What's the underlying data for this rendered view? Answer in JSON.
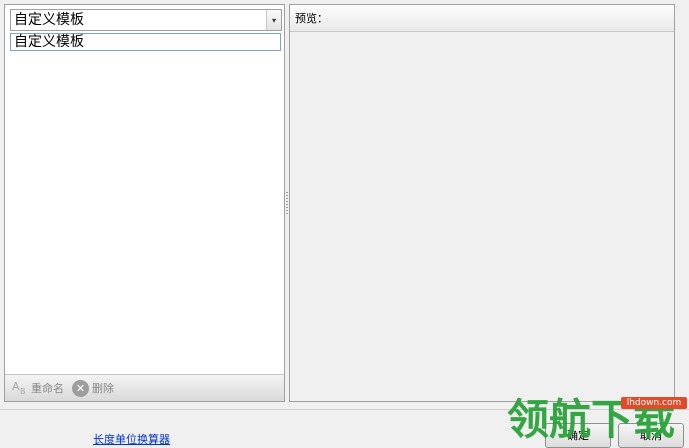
{
  "template_selector": {
    "selected": "自定义模板",
    "dropdown_glyph": "▾"
  },
  "template_list": {
    "items": [
      "自定义模板"
    ]
  },
  "left_toolbar": {
    "rename_label": "重命名",
    "delete_label": "删除",
    "rename_icon": "ab-rename-icon",
    "delete_icon": "x-circle-icon"
  },
  "preview": {
    "header": "预览："
  },
  "footer": {
    "link_label": "长度单位换算器",
    "ok_label": "确定",
    "cancel_label": "取消"
  },
  "watermark": {
    "text": "领航下载",
    "site": "lhdown.com"
  },
  "colors": {
    "link": "#0033cc",
    "watermark": "#2aa33a",
    "watermark_tag": "#e04b2a",
    "selection_border": "#7da2ce"
  }
}
